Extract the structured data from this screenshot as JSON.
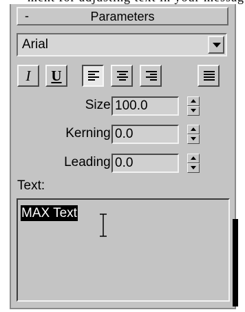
{
  "rollout": {
    "collapse_symbol": "-",
    "title": "Parameters"
  },
  "font": {
    "selected": "Arial"
  },
  "style_buttons": [
    {
      "icon": "italic-icon",
      "glyph": "I"
    },
    {
      "icon": "underline-icon",
      "glyph": "U"
    },
    {
      "icon": "align-left-icon",
      "pressed": true
    },
    {
      "icon": "align-center-icon"
    },
    {
      "icon": "align-right-icon"
    },
    {
      "icon": "align-justify-icon"
    }
  ],
  "size": {
    "label": "Size:",
    "value": "100.0"
  },
  "kerning": {
    "label": "Kerning:",
    "value": "0.0"
  },
  "leading": {
    "label": "Leading:",
    "value": "0.0"
  },
  "text": {
    "label": "Text:",
    "value": "MAX Text"
  },
  "colors": {
    "panel": "#c4c4c4",
    "selection": "#000000"
  }
}
